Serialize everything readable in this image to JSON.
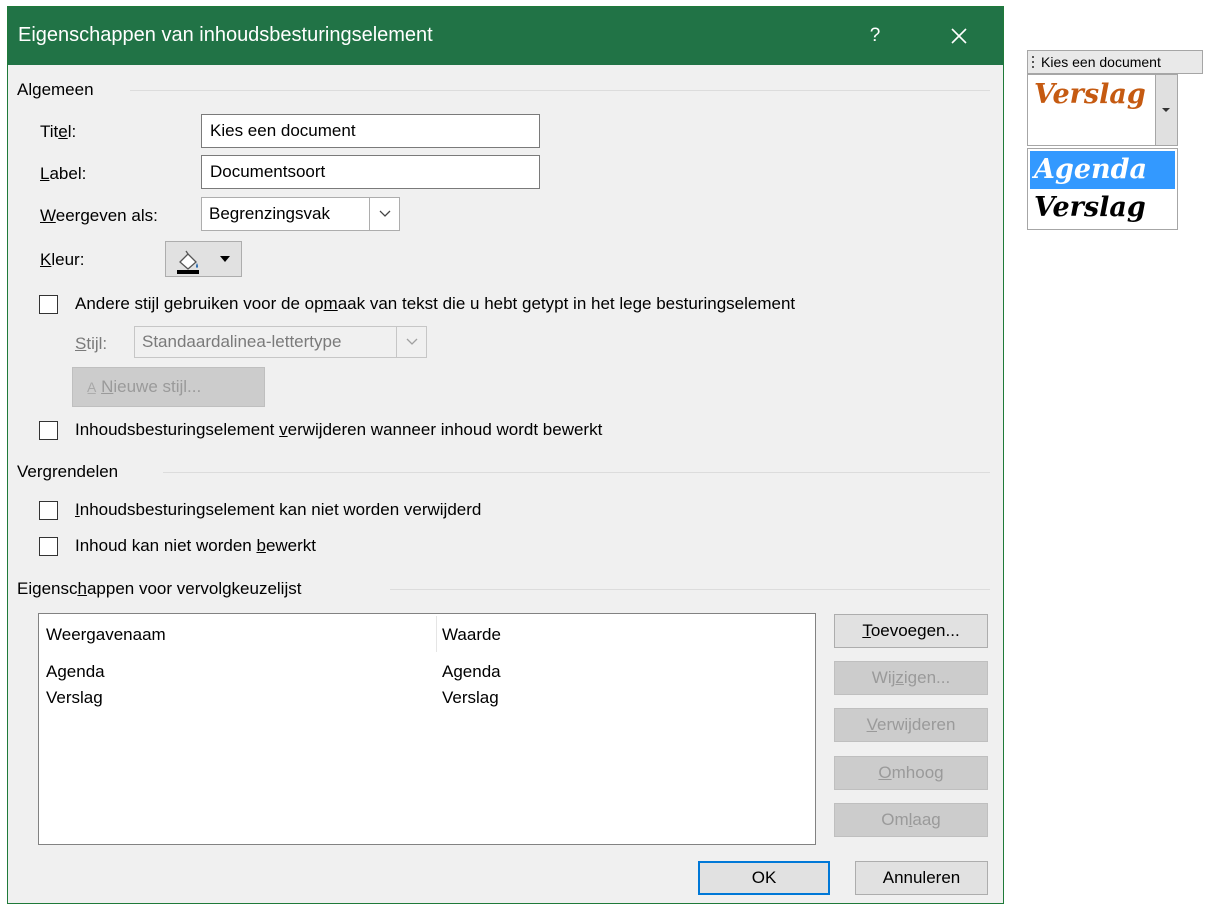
{
  "dialog": {
    "title": "Eigenschappen van inhoudsbesturingselement",
    "help": "?",
    "accent_color": "#217346"
  },
  "general": {
    "heading": "Algemeen",
    "title_label_pre": "Tit",
    "title_label_u": "e",
    "title_label_post": "l:",
    "title_value": "Kies een document",
    "tag_label_pre": "",
    "tag_label_u": "L",
    "tag_label_post": "abel:",
    "tag_value": "Documentsoort",
    "show_as_label_pre": "",
    "show_as_label_u": "W",
    "show_as_label_post": "eergeven als:",
    "show_as_value": "Begrenzingsvak",
    "color_label_pre": "",
    "color_label_u": "K",
    "color_label_post": "leur:",
    "use_style_pre": "Andere stijl gebruiken voor de op",
    "use_style_u": "m",
    "use_style_post": "aak van tekst die u hebt getypt in het lege besturingselement",
    "use_style_checked": false,
    "style_label_pre": "",
    "style_label_u": "S",
    "style_label_post": "tijl:",
    "style_value": "Standaardalinea-lettertype",
    "new_style_u": "N",
    "new_style_post": "ieuwe stijl...",
    "remove_pre": "Inhoudsbesturingselement ",
    "remove_u": "v",
    "remove_post": "erwijderen wanneer inhoud wordt bewerkt",
    "remove_checked": false
  },
  "locking": {
    "heading": "Vergrendelen",
    "cannot_delete_pre": "",
    "cannot_delete_u": "I",
    "cannot_delete_post": "nhoudsbesturingselement kan niet worden verwijderd",
    "cannot_delete_checked": false,
    "cannot_edit_pre": "Inhoud kan niet worden ",
    "cannot_edit_u": "b",
    "cannot_edit_post": "ewerkt",
    "cannot_edit_checked": false
  },
  "dropdown_props": {
    "heading_pre": "Eigensc",
    "heading_u": "h",
    "heading_post": "appen voor vervolgkeuzelijst",
    "columns": [
      "Weergavenaam",
      "Waarde"
    ],
    "rows": [
      {
        "name": "Agenda",
        "value": "Agenda"
      },
      {
        "name": "Verslag",
        "value": "Verslag"
      }
    ],
    "add_u": "T",
    "add_post": "oevoegen...",
    "modify_pre": "Wij",
    "modify_u": "z",
    "modify_post": "igen...",
    "delete_pre": "",
    "delete_u": "V",
    "delete_post": "erwijderen",
    "up_pre": "",
    "up_u": "O",
    "up_post": "mhoog",
    "down_pre": "Om",
    "down_u": "l",
    "down_post": "aag"
  },
  "footer": {
    "ok": "OK",
    "cancel": "Annuleren"
  },
  "preview": {
    "tag": "Kies een document",
    "value": "Verslag",
    "value_color": "#c55a11",
    "items": [
      "Agenda",
      "Verslag"
    ],
    "selected_index": 0,
    "selection_color": "#3399ff"
  }
}
